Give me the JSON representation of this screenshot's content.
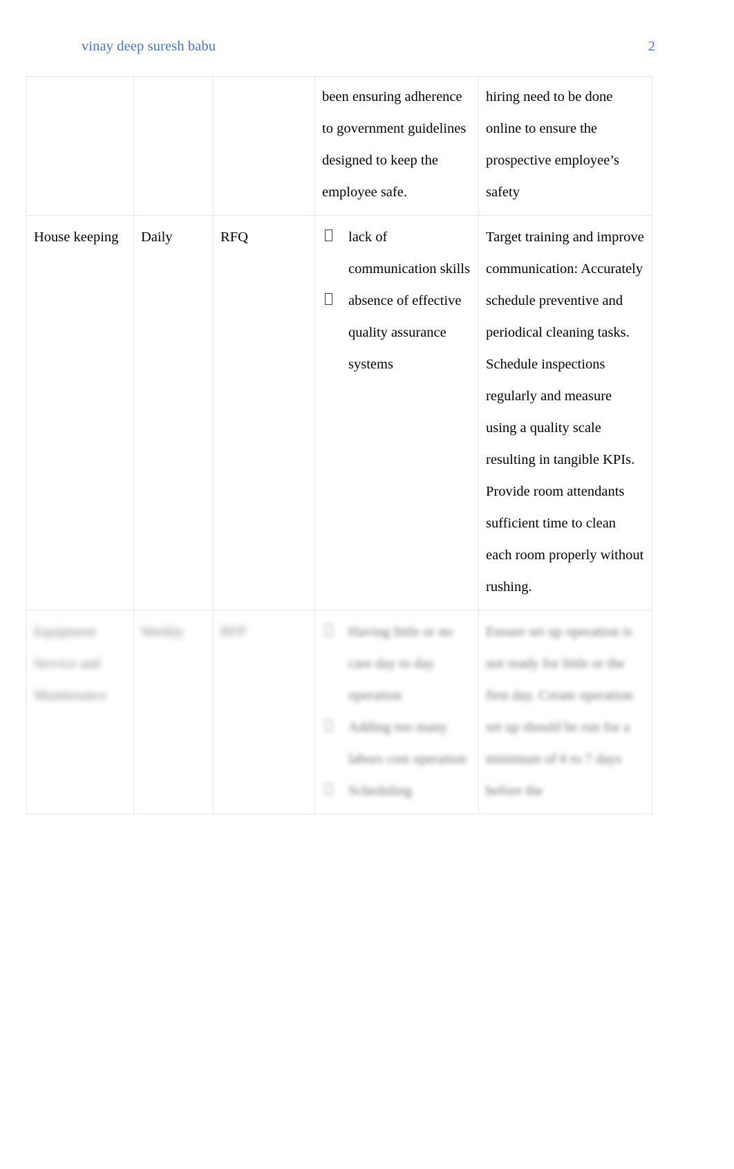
{
  "header": {
    "author": "vinay deep suresh babu",
    "page_number": "2"
  },
  "table": {
    "rows": [
      {
        "type": "continued",
        "col1": "",
        "col2": "",
        "col3": "",
        "col4_text": "been ensuring adherence to government guidelines designed to keep the employee safe.",
        "col5_text": "hiring need to be done online to ensure the prospective employee’s safety"
      },
      {
        "type": "normal",
        "col1": "House keeping",
        "col2": "Daily",
        "col3": "RFQ",
        "col4_bullets": [
          "lack of communication skills",
          "absence of effective quality assurance systems"
        ],
        "col5_text": "Target training and improve communication: Accurately schedule preventive and periodical cleaning tasks. Schedule inspections regularly and measure using a quality scale resulting in tangible KPIs. Provide room attendants sufficient time to clean each room properly without rushing."
      },
      {
        "type": "blurred",
        "col1": "Equipment Service and Maintenance",
        "col2": "Weekly",
        "col3": "RFP",
        "col4_bullets": [
          "Having little or no care day to day operation",
          "Adding too many labors cost operation",
          "Scheduling"
        ],
        "col5_text": "Ensure set up operation is not ready for little or the first day. Create operation set up should be run for a minimum of 6 to 7 days before the"
      }
    ]
  }
}
